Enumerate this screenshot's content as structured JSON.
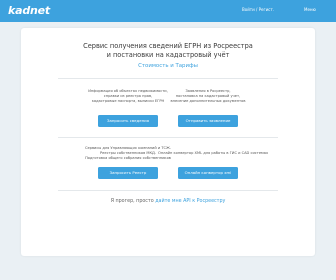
{
  "header": {
    "logo": "kadnet",
    "links": [
      "Войти / Регист.",
      "Меню"
    ]
  },
  "main": {
    "title_line1": "Сервис получения сведений ЕГРН из Росреестра",
    "title_line2": "и постановки на кадастровый учёт",
    "pricing_link": "Стоимость и Тарифы"
  },
  "services": [
    {
      "desc": [
        "Информация об объектах недвижимости,",
        "справки из реестра прав,",
        "кадастровые паспорта, выписки ЕГРН"
      ],
      "button": "Запросить сведения"
    },
    {
      "desc": [
        "Заявления в Росреестр,",
        "постановка на кадастровый учет,",
        "внесение дополнительных документов"
      ],
      "button": "Отправить заявление"
    },
    {
      "desc": [
        "Сервисы для Управляющих компаний и ТСЖ.",
        "Реестры собственников МКД.",
        "Подготовка общего собрания собственников"
      ],
      "button": "Запросить Реестр"
    },
    {
      "desc": [
        "Онлайн конвертор XML для работы в ГИС и CAD системах"
      ],
      "button": "Онлайн конвертор xml"
    }
  ],
  "footer": {
    "prefix": "Я прогер, просто",
    "link": "дайте мне API к Росреестру"
  },
  "colors": {
    "accent": "#3da2de",
    "background": "#eaf0f4",
    "card": "#ffffff"
  }
}
